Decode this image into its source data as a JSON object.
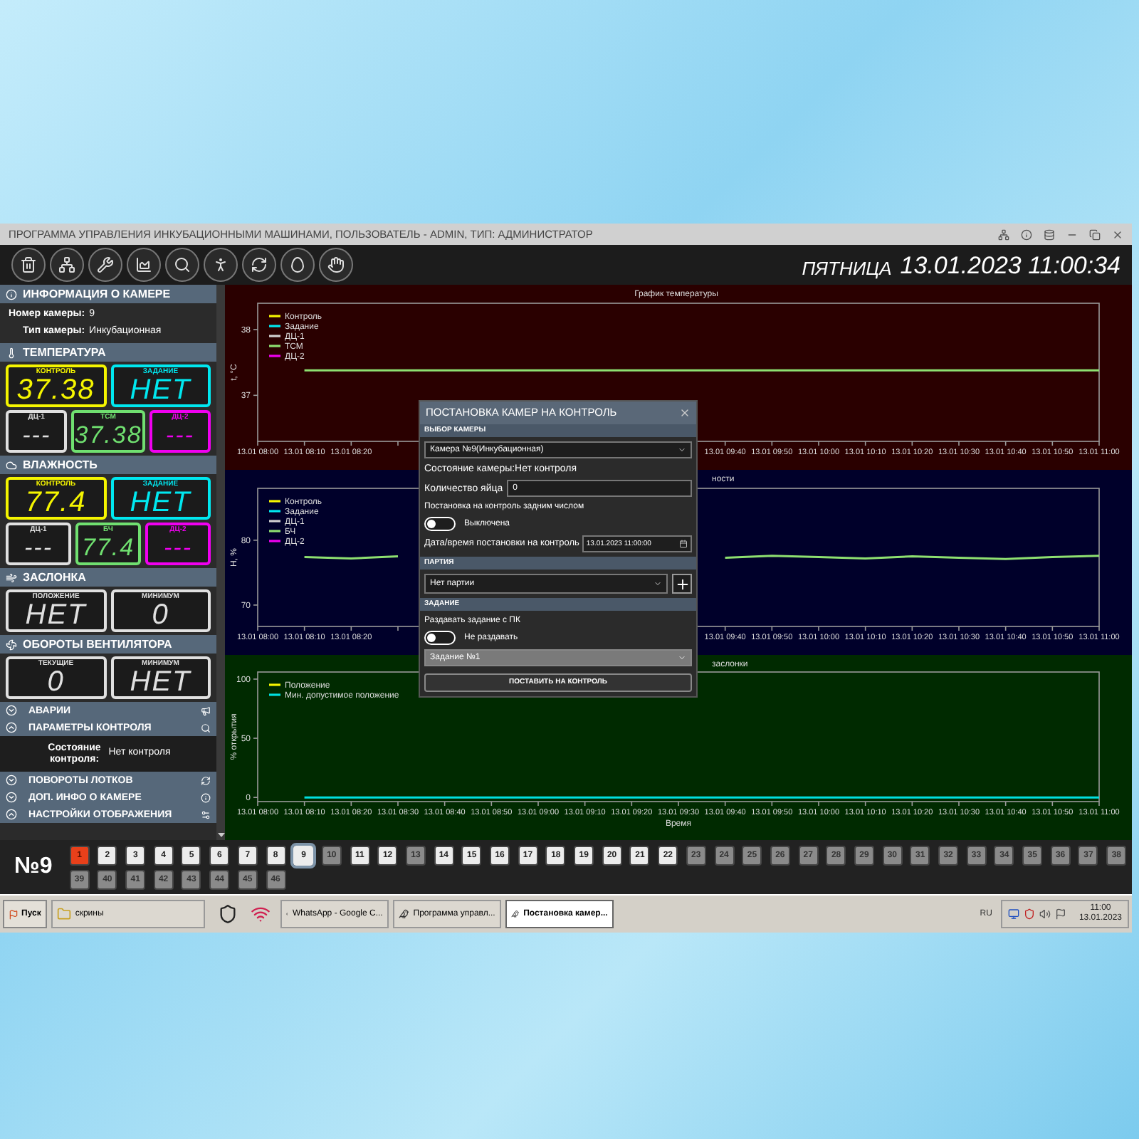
{
  "window": {
    "title": "ПРОГРАММА УПРАВЛЕНИЯ ИНКУБАЦИОННЫМИ МАШИНАМИ, ПОЛЬЗОВАТЕЛЬ - ADMIN, ТИП: АДМИНИСТРАТОР"
  },
  "clock": {
    "weekday": "ПЯТНИЦА",
    "datetime": "13.01.2023 11:00:34"
  },
  "camera_info": {
    "title": "ИНФОРМАЦИЯ О КАМЕРЕ",
    "fields": [
      {
        "label": "Номер камеры:",
        "value": "9"
      },
      {
        "label": "Тип камеры:",
        "value": "Инкубационная"
      }
    ]
  },
  "gauges": [
    {
      "title": "ТЕМПЕРАТУРА",
      "main": [
        {
          "label": "КОНТРОЛЬ",
          "value": "37.38",
          "color": "#f5f500"
        },
        {
          "label": "ЗАДАНИЕ",
          "value": "НЕТ",
          "color": "#00e8f0"
        }
      ],
      "sensors": [
        {
          "label": "ДЦ-1",
          "value": "---",
          "color": "#e0e0e0"
        },
        {
          "label": "ТСМ",
          "value": "37.38",
          "color": "#70e070"
        },
        {
          "label": "ДЦ-2",
          "value": "---",
          "color": "#f000f0"
        }
      ]
    },
    {
      "title": "ВЛАЖНОСТЬ",
      "main": [
        {
          "label": "КОНТРОЛЬ",
          "value": "77.4",
          "color": "#f5f500"
        },
        {
          "label": "ЗАДАНИЕ",
          "value": "НЕТ",
          "color": "#00e8f0"
        }
      ],
      "sensors": [
        {
          "label": "ДЦ-1",
          "value": "---",
          "color": "#e0e0e0"
        },
        {
          "label": "БЧ",
          "value": "77.4",
          "color": "#70e070"
        },
        {
          "label": "ДЦ-2",
          "value": "---",
          "color": "#f000f0"
        }
      ]
    },
    {
      "title": "ЗАСЛОНКА",
      "main": [
        {
          "label": "ПОЛОЖЕНИЕ",
          "value": "НЕТ",
          "color": "#e0e0e0"
        },
        {
          "label": "МИНИМУМ",
          "value": "0",
          "color": "#e0e0e0"
        }
      ]
    },
    {
      "title": "ОБОРОТЫ ВЕНТИЛЯТОРА",
      "main": [
        {
          "label": "ТЕКУЩИЕ",
          "value": "0",
          "color": "#e0e0e0"
        },
        {
          "label": "МИНИМУМ",
          "value": "НЕТ",
          "color": "#e0e0e0"
        }
      ]
    }
  ],
  "accordion": [
    {
      "title": "АВАРИИ",
      "expanded": false
    },
    {
      "title": "ПАРАМЕТРЫ КОНТРОЛЯ",
      "expanded": true,
      "content": {
        "label": "Состояние контроля:",
        "value": "Нет контроля"
      }
    },
    {
      "title": "ПОВОРОТЫ ЛОТКОВ",
      "expanded": false
    },
    {
      "title": "ДОП. ИНФО О КАМЕРЕ",
      "expanded": false
    },
    {
      "title": "НАСТРОЙКИ ОТОБРАЖЕНИЯ",
      "expanded": true
    }
  ],
  "charts": [
    {
      "chart_data": {
        "type": "line",
        "title": "График температуры",
        "ylabel": "t, °C",
        "ylim": [
          36.3,
          38.4
        ],
        "yticks": [
          37,
          38
        ],
        "categories": [
          "13.01 08:00",
          "13.01 08:10",
          "13.01 08:20",
          null,
          null,
          null,
          null,
          null,
          null,
          null,
          "13.01 09:40",
          "13.01 09:50",
          "13.01 10:00",
          "13.01 10:10",
          "13.01 10:20",
          "13.01 10:30",
          "13.01 10:40",
          "13.01 10:50",
          "13.01 11:00"
        ],
        "series": [
          {
            "name": "Контроль",
            "color": "#f5f500",
            "values": [
              null,
              null,
              null,
              null,
              null,
              null,
              null,
              null,
              null,
              null,
              null,
              null,
              null,
              null,
              null,
              null,
              null,
              null,
              null
            ]
          },
          {
            "name": "Задание",
            "color": "#00e8f0",
            "values": [
              null,
              null,
              null,
              null,
              null,
              null,
              null,
              null,
              null,
              null,
              null,
              null,
              null,
              null,
              null,
              null,
              null,
              null,
              null
            ]
          },
          {
            "name": "ДЦ-1",
            "color": "#d0d0d0",
            "values": [
              null,
              null,
              null,
              null,
              null,
              null,
              null,
              null,
              null,
              null,
              null,
              null,
              null,
              null,
              null,
              null,
              null,
              null,
              null
            ]
          },
          {
            "name": "ТСМ",
            "color": "#8ee070",
            "values": [
              null,
              37.38,
              37.38,
              37.38,
              37.38,
              37.38,
              37.38,
              37.38,
              37.38,
              37.38,
              37.38,
              37.38,
              37.38,
              37.38,
              37.38,
              37.38,
              37.38,
              37.38,
              37.38
            ]
          },
          {
            "name": "ДЦ-2",
            "color": "#f000f0",
            "values": [
              null,
              null,
              null,
              null,
              null,
              null,
              null,
              null,
              null,
              null,
              null,
              null,
              null,
              null,
              null,
              null,
              null,
              null,
              null
            ]
          }
        ]
      }
    },
    {
      "chart_data": {
        "type": "line",
        "title": "ности",
        "ylabel": "H, %",
        "ylim": [
          66.7,
          88
        ],
        "yticks": [
          70,
          80
        ],
        "categories": [
          "13.01 08:00",
          "13.01 08:10",
          "13.01 08:20",
          null,
          null,
          null,
          null,
          null,
          null,
          null,
          "13.01 09:40",
          "13.01 09:50",
          "13.01 10:00",
          "13.01 10:10",
          "13.01 10:20",
          "13.01 10:30",
          "13.01 10:40",
          "13.01 10:50",
          "13.01 11:00"
        ],
        "series": [
          {
            "name": "Контроль",
            "color": "#f5f500",
            "values": [
              null,
              null,
              null,
              null,
              null,
              null,
              null,
              null,
              null,
              null,
              null,
              null,
              null,
              null,
              null,
              null,
              null,
              null,
              null
            ]
          },
          {
            "name": "Задание",
            "color": "#00e8f0",
            "values": [
              null,
              null,
              null,
              null,
              null,
              null,
              null,
              null,
              null,
              null,
              null,
              null,
              null,
              null,
              null,
              null,
              null,
              null,
              null
            ]
          },
          {
            "name": "ДЦ-1",
            "color": "#d0d0d0",
            "values": [
              null,
              null,
              null,
              null,
              null,
              null,
              null,
              null,
              null,
              null,
              null,
              null,
              null,
              null,
              null,
              null,
              null,
              null,
              null
            ]
          },
          {
            "name": "БЧ",
            "color": "#8ee070",
            "values": [
              null,
              77.4,
              77.2,
              77.5,
              null,
              null,
              null,
              null,
              null,
              null,
              77.3,
              77.6,
              77.4,
              77.2,
              77.5,
              77.3,
              77.1,
              77.4,
              77.6
            ]
          },
          {
            "name": "ДЦ-2",
            "color": "#f000f0",
            "values": [
              null,
              null,
              null,
              null,
              null,
              null,
              null,
              null,
              null,
              null,
              null,
              null,
              null,
              null,
              null,
              null,
              null,
              null,
              null
            ]
          }
        ]
      }
    },
    {
      "chart_data": {
        "type": "line",
        "title": "заслонки",
        "xlabel": "Время",
        "ylabel": "% открытия",
        "ylim": [
          -3.5,
          106
        ],
        "yticks": [
          0,
          50,
          100
        ],
        "categories": [
          "13.01 08:00",
          "13.01 08:10",
          "13.01 08:20",
          "13.01 08:30",
          "13.01 08:40",
          "13.01 08:50",
          "13.01 09:00",
          "13.01 09:10",
          "13.01 09:20",
          "13.01 09:30",
          "13.01 09:40",
          "13.01 09:50",
          "13.01 10:00",
          "13.01 10:10",
          "13.01 10:20",
          "13.01 10:30",
          "13.01 10:40",
          "13.01 10:50",
          "13.01 11:00"
        ],
        "series": [
          {
            "name": "Положение",
            "color": "#f5f500",
            "values": [
              null,
              null,
              null,
              null,
              null,
              null,
              null,
              null,
              null,
              null,
              null,
              null,
              null,
              null,
              null,
              null,
              null,
              null,
              null
            ]
          },
          {
            "name": "Мин. допустимое положение",
            "color": "#00e0e0",
            "values": [
              null,
              0,
              0,
              0,
              0,
              0,
              0,
              0,
              0,
              0,
              0,
              0,
              0,
              0,
              0,
              0,
              0,
              0,
              0
            ]
          }
        ]
      }
    }
  ],
  "dialog": {
    "title": "ПОСТАНОВКА КАМЕР НА КОНТРОЛЬ",
    "camera_section": "ВЫБОР КАМЕРЫ",
    "camera_select": "Камера №9(Инкубационная)",
    "state_text": "Состояние камеры:Нет контроля",
    "egg_count": {
      "label": "Количество яйца",
      "value": "0"
    },
    "backdate": {
      "label": "Постановка на контроль задним числом",
      "on": false,
      "state_label": "Выключена"
    },
    "datetime": {
      "label": "Дата/время постановки на контроль",
      "value": "13.01.2023 11:00:00"
    },
    "batch_section": "ПАРТИЯ",
    "batch_select": "Нет партии",
    "task_section": "ЗАДАНИЕ",
    "distribute": {
      "label": "Раздавать задание с ПК",
      "on": false,
      "state_label": "Не раздавать"
    },
    "task_select": "Задание №1",
    "submit": "ПОСТАВИТЬ НА КОНТРОЛЬ"
  },
  "camera_bar": {
    "current": "№9",
    "cameras": [
      {
        "label": "1",
        "kind": "alarm",
        "selected": false
      },
      {
        "label": "2",
        "kind": "active",
        "selected": false
      },
      {
        "label": "3",
        "kind": "active",
        "selected": false
      },
      {
        "label": "4",
        "kind": "active",
        "selected": false
      },
      {
        "label": "5",
        "kind": "active",
        "selected": false
      },
      {
        "label": "6",
        "kind": "active",
        "selected": false
      },
      {
        "label": "7",
        "kind": "active",
        "selected": false
      },
      {
        "label": "8",
        "kind": "active",
        "selected": false
      },
      {
        "label": "9",
        "kind": "active",
        "selected": true
      },
      {
        "label": "10",
        "kind": "inactive",
        "selected": false
      },
      {
        "label": "11",
        "kind": "active",
        "selected": false
      },
      {
        "label": "12",
        "kind": "active",
        "selected": false
      },
      {
        "label": "13",
        "kind": "inactive",
        "selected": false
      },
      {
        "label": "14",
        "kind": "active",
        "selected": false
      },
      {
        "label": "15",
        "kind": "active",
        "selected": false
      },
      {
        "label": "16",
        "kind": "active",
        "selected": false
      },
      {
        "label": "17",
        "kind": "active",
        "selected": false
      },
      {
        "label": "18",
        "kind": "active",
        "selected": false
      },
      {
        "label": "19",
        "kind": "active",
        "selected": false
      },
      {
        "label": "20",
        "kind": "active",
        "selected": false
      },
      {
        "label": "21",
        "kind": "active",
        "selected": false
      },
      {
        "label": "22",
        "kind": "active",
        "selected": false
      },
      {
        "label": "23",
        "kind": "inactive",
        "selected": false
      },
      {
        "label": "24",
        "kind": "inactive",
        "selected": false
      },
      {
        "label": "25",
        "kind": "inactive",
        "selected": false
      },
      {
        "label": "26",
        "kind": "inactive",
        "selected": false
      },
      {
        "label": "27",
        "kind": "inactive",
        "selected": false
      },
      {
        "label": "28",
        "kind": "inactive",
        "selected": false
      },
      {
        "label": "29",
        "kind": "inactive",
        "selected": false
      },
      {
        "label": "30",
        "kind": "inactive",
        "selected": false
      },
      {
        "label": "31",
        "kind": "inactive",
        "selected": false
      },
      {
        "label": "32",
        "kind": "inactive",
        "selected": false
      },
      {
        "label": "33",
        "kind": "inactive",
        "selected": false
      },
      {
        "label": "34",
        "kind": "inactive",
        "selected": false
      },
      {
        "label": "35",
        "kind": "inactive",
        "selected": false
      },
      {
        "label": "36",
        "kind": "inactive",
        "selected": false
      },
      {
        "label": "37",
        "kind": "inactive",
        "selected": false
      },
      {
        "label": "38",
        "kind": "inactive",
        "selected": false
      },
      {
        "label": "39",
        "kind": "inactive",
        "selected": false
      },
      {
        "label": "40",
        "kind": "inactive",
        "selected": false
      },
      {
        "label": "41",
        "kind": "inactive",
        "selected": false
      },
      {
        "label": "42",
        "kind": "inactive",
        "selected": false
      },
      {
        "label": "43",
        "kind": "inactive",
        "selected": false
      },
      {
        "label": "44",
        "kind": "inactive",
        "selected": false
      },
      {
        "label": "45",
        "kind": "inactive",
        "selected": false
      },
      {
        "label": "46",
        "kind": "inactive",
        "selected": false
      }
    ]
  },
  "taskbar": {
    "start": "Пуск",
    "items": [
      {
        "label": "скрины",
        "selected": false
      },
      {
        "label": "WhatsApp - Google C...",
        "selected": false
      },
      {
        "label": "Программа управл...",
        "selected": false
      },
      {
        "label": "Постановка камер...",
        "selected": true
      }
    ],
    "language": "RU",
    "time": "11:00",
    "date": "13.01.2023"
  }
}
